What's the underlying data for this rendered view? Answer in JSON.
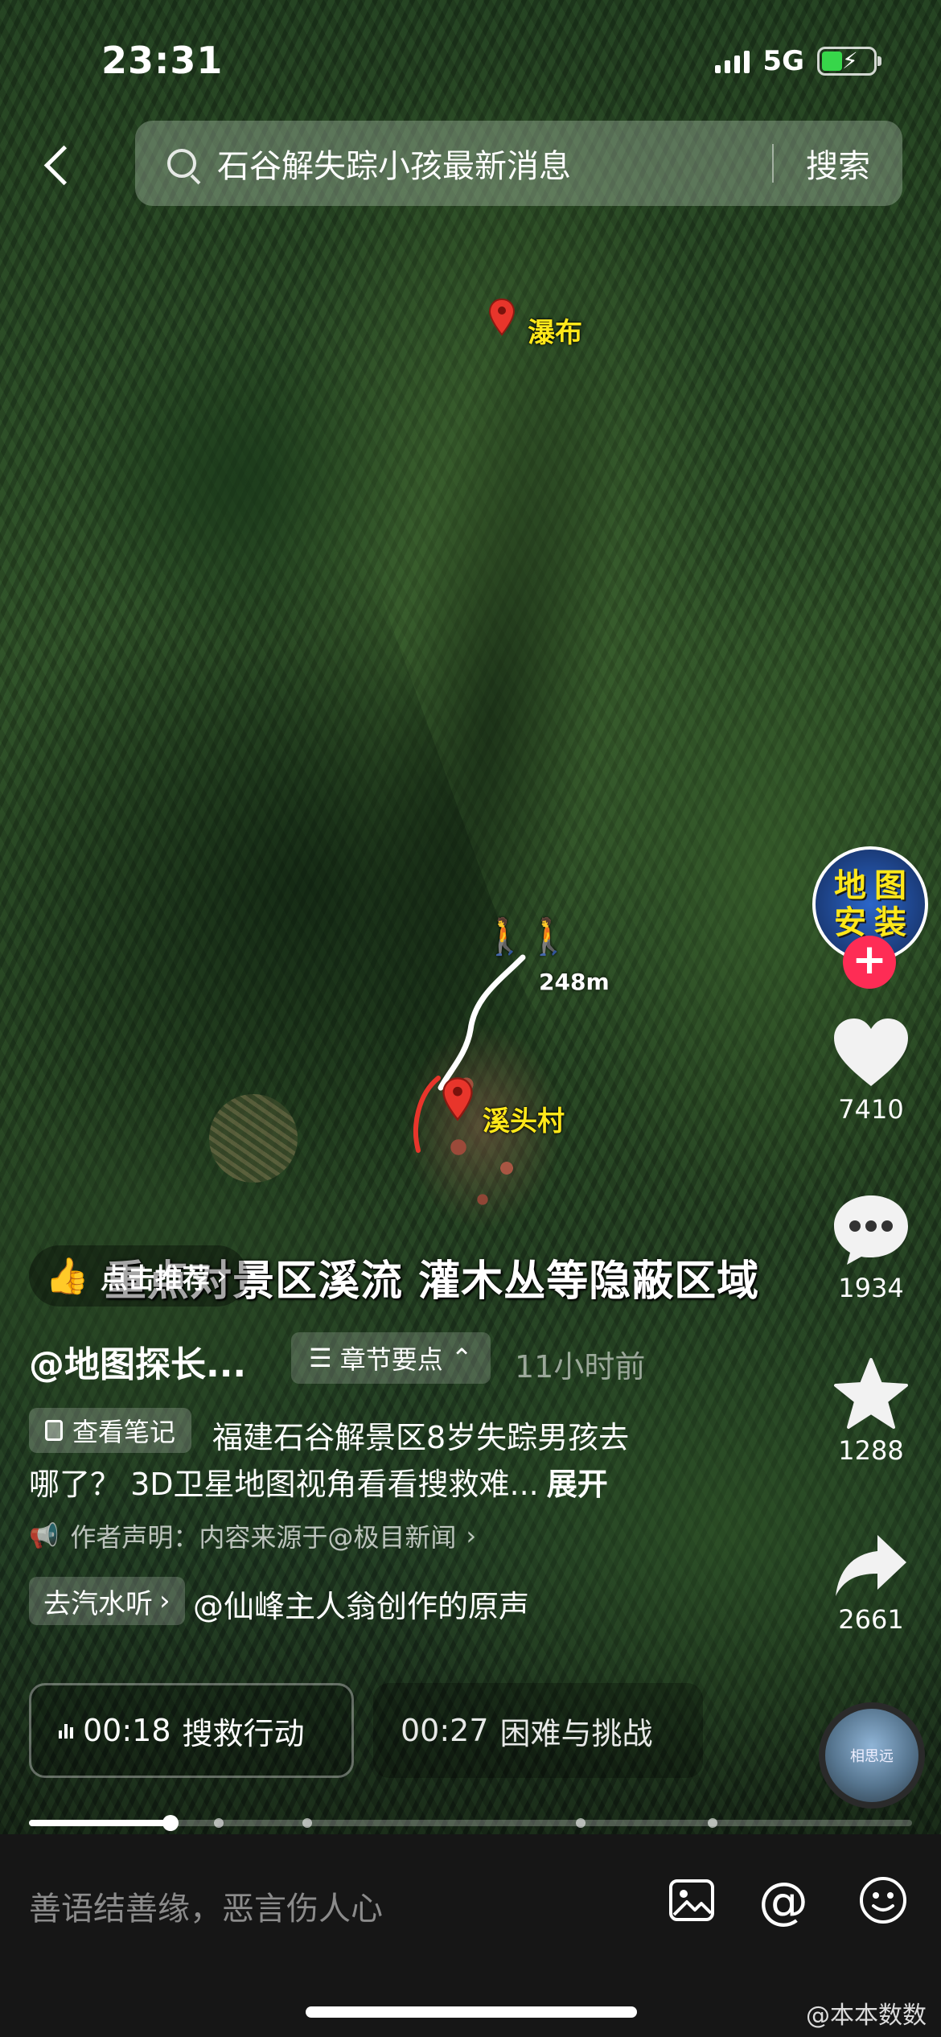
{
  "status_bar": {
    "time": "23:31",
    "network": "5G"
  },
  "search": {
    "query": "石谷解失踪小孩最新消息",
    "button": "搜索"
  },
  "map": {
    "labels": {
      "waterfall": "瀑布",
      "village": "溪头村"
    },
    "distance": "248m"
  },
  "overlay": {
    "subtitle": "重点对景区溪流 灌木丛等隐蔽区域"
  },
  "creator": {
    "avatar_text_line1": "地图",
    "avatar_text_line2": "安装",
    "follow": "+"
  },
  "actions": {
    "likes": "7410",
    "comments": "1934",
    "favorites": "1288",
    "shares": "2661"
  },
  "music_disc": {
    "text": "相思远"
  },
  "info": {
    "recommend": "点击推荐",
    "author": "@地图探长...",
    "chapter_toggle": "章节要点",
    "post_time": "11小时前",
    "note_button": "查看笔记",
    "desc_line1": "福建石谷解景区8岁失踪男孩去",
    "desc_line2": "哪了？ 3D卫星地图视角看看搜救难...",
    "expand": "展开",
    "declaration": "作者声明：内容来源于@极目新闻",
    "listen_button": "去汽水听",
    "music_credit": "@仙峰主人翁创作的原声"
  },
  "chapters": [
    {
      "time": "00:18",
      "title": "搜救行动"
    },
    {
      "time": "00:27",
      "title": "困难与挑战"
    }
  ],
  "progress": {
    "played_fraction": 0.16
  },
  "comment_bar": {
    "placeholder": "善语结善缘，恶言伤人心",
    "watermark": "@本本数数"
  },
  "colors": {
    "accent": "#fe2c55",
    "map_label": "#ffe81a",
    "hiker": "#8fe03a"
  },
  "icons": [
    "back-icon",
    "search-icon",
    "heart-icon",
    "comment-icon",
    "star-icon",
    "share-icon",
    "thumb-icon",
    "note-icon",
    "speaker-icon",
    "image-icon",
    "at-icon",
    "emoji-icon",
    "map-pin-icon",
    "hiker-icon"
  ]
}
